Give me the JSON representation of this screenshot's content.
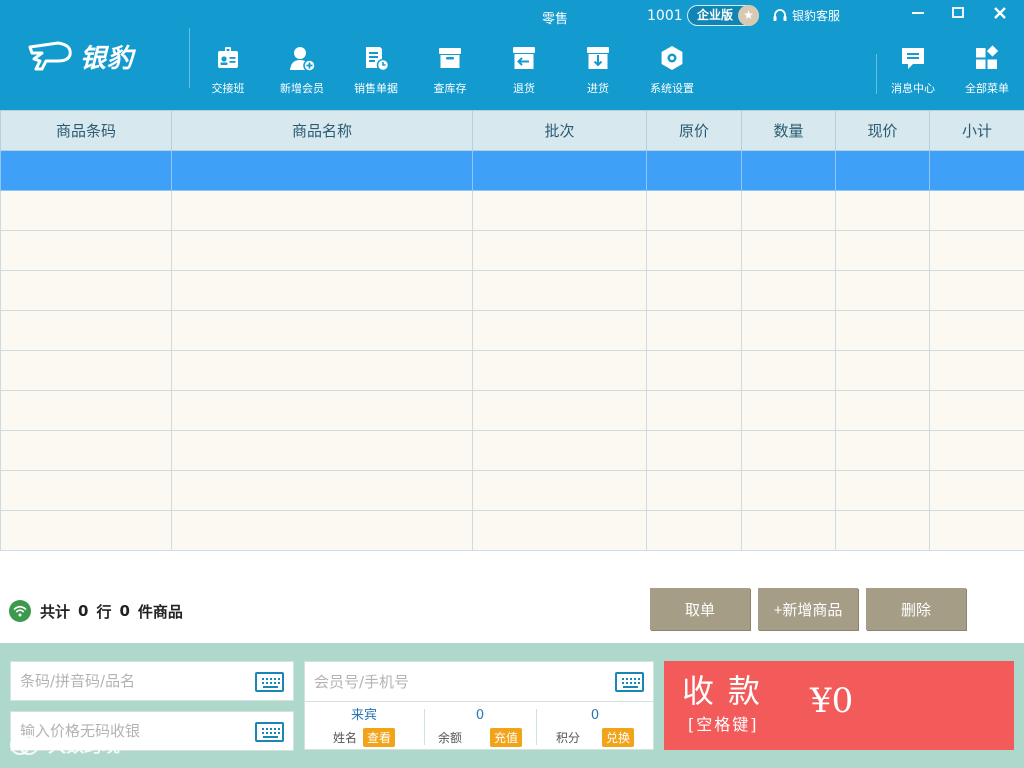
{
  "app": {
    "logo_text": "银豹",
    "mode": "零售",
    "user_id": "1001",
    "edition": "企业版",
    "service": "银豹客服"
  },
  "colors": {
    "header_bg": "#139bcf",
    "selected_row": "#3ea0f6",
    "action_button": "#a59d86",
    "pay_button": "#f35a5a",
    "bottom_panel": "#aed8cc",
    "tag": "#f1a31a"
  },
  "toolbar": {
    "items": [
      {
        "label": "交接班",
        "icon": "badge-icon"
      },
      {
        "label": "新增会员",
        "icon": "add-user-icon"
      },
      {
        "label": "销售单据",
        "icon": "receipt-icon"
      },
      {
        "label": "查库存",
        "icon": "inventory-box-icon"
      },
      {
        "label": "退货",
        "icon": "return-icon"
      },
      {
        "label": "进货",
        "icon": "restock-icon"
      },
      {
        "label": "系统设置",
        "icon": "settings-icon"
      },
      {
        "label": "消息中心",
        "icon": "message-icon"
      },
      {
        "label": "全部菜单",
        "icon": "all-menu-icon"
      }
    ]
  },
  "table": {
    "columns": [
      "商品条码",
      "商品名称",
      "批次",
      "原价",
      "数量",
      "现价",
      "小计"
    ],
    "row_count": 10,
    "selected_row": 0
  },
  "summary": {
    "prefix": "共计",
    "rows_count": "0",
    "rows_unit": "行",
    "items_count": "0",
    "items_unit": "件商品"
  },
  "actions": {
    "cancel": "取单",
    "add_product": "+新增商品",
    "delete": "删除"
  },
  "inputs": {
    "barcode_placeholder": "条码/拼音码/品名",
    "price_placeholder": "输入价格无码收银",
    "member_placeholder": "会员号/手机号"
  },
  "member": {
    "name_value": "来宾",
    "name_label": "姓名",
    "name_action": "查看",
    "balance_value": "0",
    "balance_label": "余额",
    "balance_action": "充值",
    "points_value": "0",
    "points_label": "积分",
    "points_action": "兑换"
  },
  "pay": {
    "title": "收款",
    "hint": "[空格键]",
    "amount": "¥0"
  },
  "watermark": "大数跨境"
}
